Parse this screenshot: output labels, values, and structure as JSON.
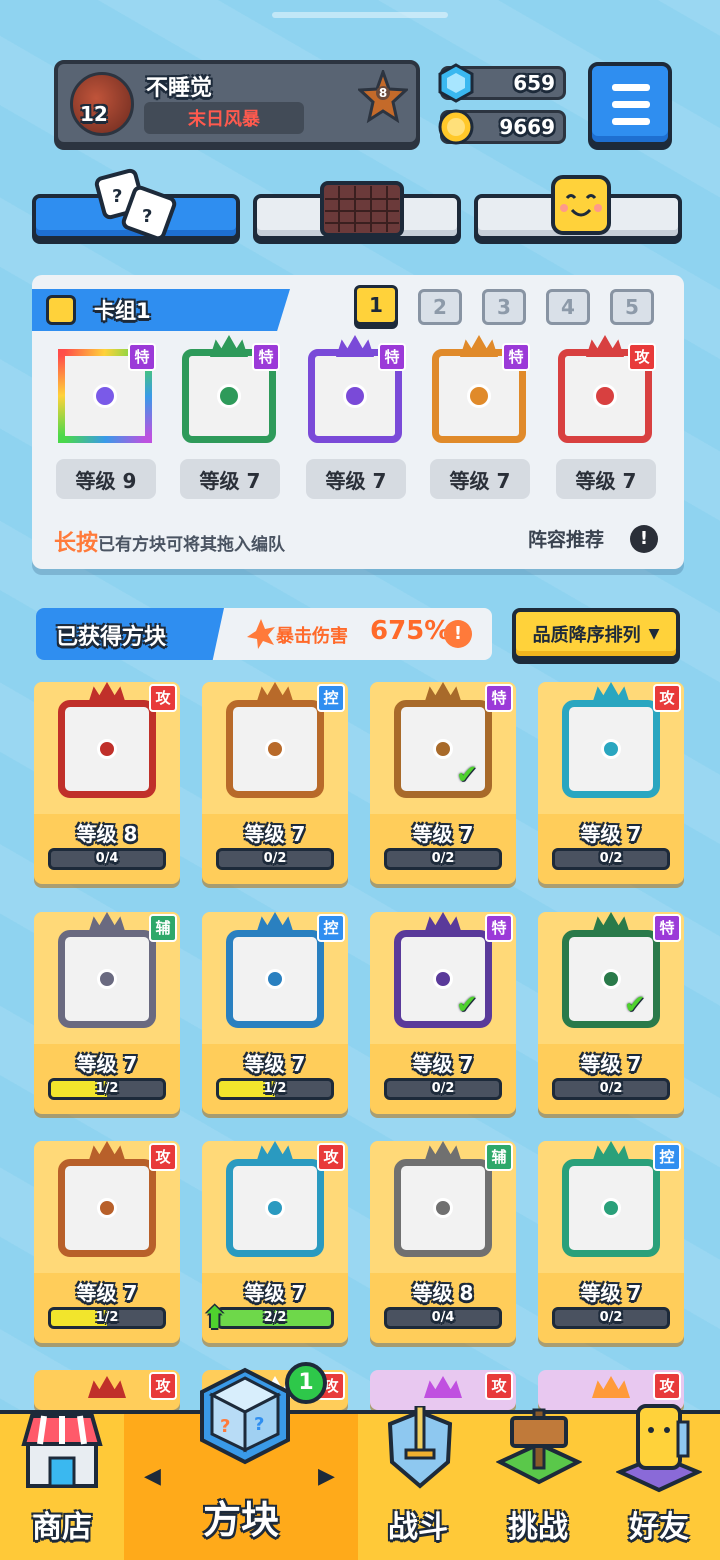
{
  "profile": {
    "name": "不睡觉",
    "title": "末日风暴",
    "level": "12",
    "rank": "8"
  },
  "currency": {
    "gems": "659",
    "coins": "9669"
  },
  "deck": {
    "label": "卡组1",
    "numbers": [
      "1",
      "2",
      "3",
      "4",
      "5"
    ],
    "active_index": 0,
    "cards": [
      {
        "type": "特",
        "level": "等级 9",
        "color": "#c050e0"
      },
      {
        "type": "特",
        "level": "等级 7",
        "color": "#2e9a5a"
      },
      {
        "type": "特",
        "level": "等级 7",
        "color": "#7a4ad8"
      },
      {
        "type": "特",
        "level": "等级 7",
        "color": "#e08a2a"
      },
      {
        "type": "攻",
        "level": "等级 7",
        "color": "#d84040"
      }
    ],
    "hint_highlight": "长按",
    "hint_text": "已有方块可将其拖入编队",
    "recommend": "阵容推荐",
    "info_icon": "!"
  },
  "obtained": {
    "label": "已获得方块",
    "crit_label": "暴击伤害",
    "crit_value": "675%",
    "sort_label": "品质降序排列",
    "info_icon": "!"
  },
  "grid": [
    {
      "type": "攻",
      "badge": "atk",
      "level": "等级 8",
      "progress": "0/4",
      "fraction": 0,
      "frame": "#c0302a",
      "checked": false
    },
    {
      "type": "控",
      "badge": "ctl",
      "level": "等级 7",
      "progress": "0/2",
      "fraction": 0,
      "frame": "#b86a2a",
      "checked": false
    },
    {
      "type": "特",
      "badge": "spc",
      "level": "等级 7",
      "progress": "0/2",
      "fraction": 0,
      "frame": "#a86a2a",
      "checked": true
    },
    {
      "type": "攻",
      "badge": "atk",
      "level": "等级 7",
      "progress": "0/2",
      "fraction": 0,
      "frame": "#2aa6c0",
      "checked": false
    },
    {
      "type": "辅",
      "badge": "sup",
      "level": "等级 7",
      "progress": "1/2",
      "fraction": 0.5,
      "frame": "#6a6a80",
      "checked": false
    },
    {
      "type": "控",
      "badge": "ctl",
      "level": "等级 7",
      "progress": "1/2",
      "fraction": 0.5,
      "frame": "#2a80c0",
      "checked": false
    },
    {
      "type": "特",
      "badge": "spc",
      "level": "等级 7",
      "progress": "0/2",
      "fraction": 0,
      "frame": "#5a3a9a",
      "checked": true
    },
    {
      "type": "特",
      "badge": "spc",
      "level": "等级 7",
      "progress": "0/2",
      "fraction": 0,
      "frame": "#2a7a4a",
      "checked": true
    },
    {
      "type": "攻",
      "badge": "atk",
      "level": "等级 7",
      "progress": "1/2",
      "fraction": 0.5,
      "frame": "#b8602a",
      "checked": false
    },
    {
      "type": "攻",
      "badge": "atk",
      "level": "等级 7",
      "progress": "2/2",
      "fraction": 1,
      "frame": "#2a9ac0",
      "checked": false,
      "upgrade": true
    },
    {
      "type": "辅",
      "badge": "sup",
      "level": "等级 8",
      "progress": "0/4",
      "fraction": 0,
      "frame": "#707070",
      "checked": false
    },
    {
      "type": "控",
      "badge": "ctl",
      "level": "等级 7",
      "progress": "0/2",
      "fraction": 0,
      "frame": "#2aa07a",
      "checked": false
    }
  ],
  "partial_row": [
    {
      "type": "攻"
    },
    {
      "type": "攻"
    },
    {
      "type": "攻"
    },
    {
      "type": "攻"
    }
  ],
  "nav": {
    "shop": "商店",
    "blocks": "方块",
    "battle": "战斗",
    "challenge": "挑战",
    "friends": "好友",
    "blocks_notification": "1",
    "arrow_left": "◀",
    "arrow_right": "▶"
  },
  "icons": {
    "gem": "gem-icon",
    "coin": "coin-icon",
    "menu": "menu-icon",
    "dice": "dice-icon",
    "board": "board-icon",
    "emote": "emote-icon",
    "pencil": "pencil-icon",
    "star": "rank-star-icon"
  },
  "colors": {
    "accent_blue": "#2f8ef0",
    "yellow": "#ffd23a",
    "nav_bg": "#ffc938",
    "crit": "#ff6a2a"
  }
}
